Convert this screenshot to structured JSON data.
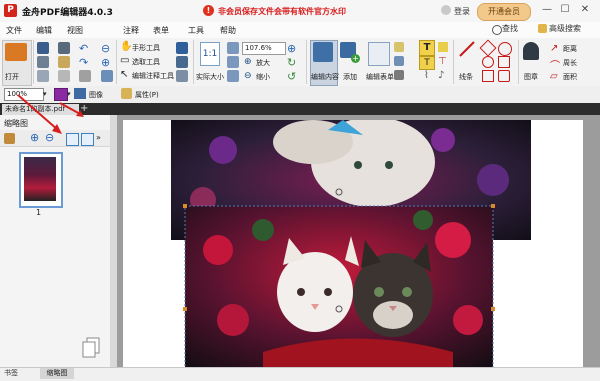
{
  "app": {
    "title": "金舟PDF编辑器4.0.3",
    "logo_letter": "P",
    "notice": "非会员保存文件会带有软件官方水印",
    "login": "登录",
    "vip": "开通会员"
  },
  "window_controls": {
    "minimize": "—",
    "maximize": "☐",
    "close": "✕"
  },
  "menu": {
    "items": [
      "文件",
      "编辑",
      "视图",
      "注释",
      "表单",
      "工具",
      "帮助"
    ],
    "search": "查找",
    "advanced_search": "高级搜索"
  },
  "ribbon": {
    "open": "打开",
    "hand_tool": "手形工具",
    "select_tool": "选取工具",
    "edit_annotation": "编辑注释工具",
    "actual_size": "实际大小",
    "zoom_value": "107.6%",
    "zoom_in": "放大",
    "zoom_out": "缩小",
    "edit_content": "编辑内容",
    "add": "添加",
    "edit_form": "编辑表单",
    "line": "线条",
    "stamp": "图章",
    "distance": "距离",
    "perimeter": "周长",
    "area": "面积"
  },
  "toolbar2": {
    "zoom": "100%",
    "image": "图像",
    "properties": "属性(P)"
  },
  "doc_tab": {
    "name": "未命名1的副本.pdf",
    "add": "+"
  },
  "panel": {
    "title": "缩略图",
    "thumbnail_page": "1"
  },
  "status": {
    "tab1": "书签",
    "tab2": "缩略图"
  },
  "colors": {
    "accent_red": "#d71c1c",
    "vip_gold": "#f3c98b",
    "selection_blue": "#6a9bd4"
  }
}
